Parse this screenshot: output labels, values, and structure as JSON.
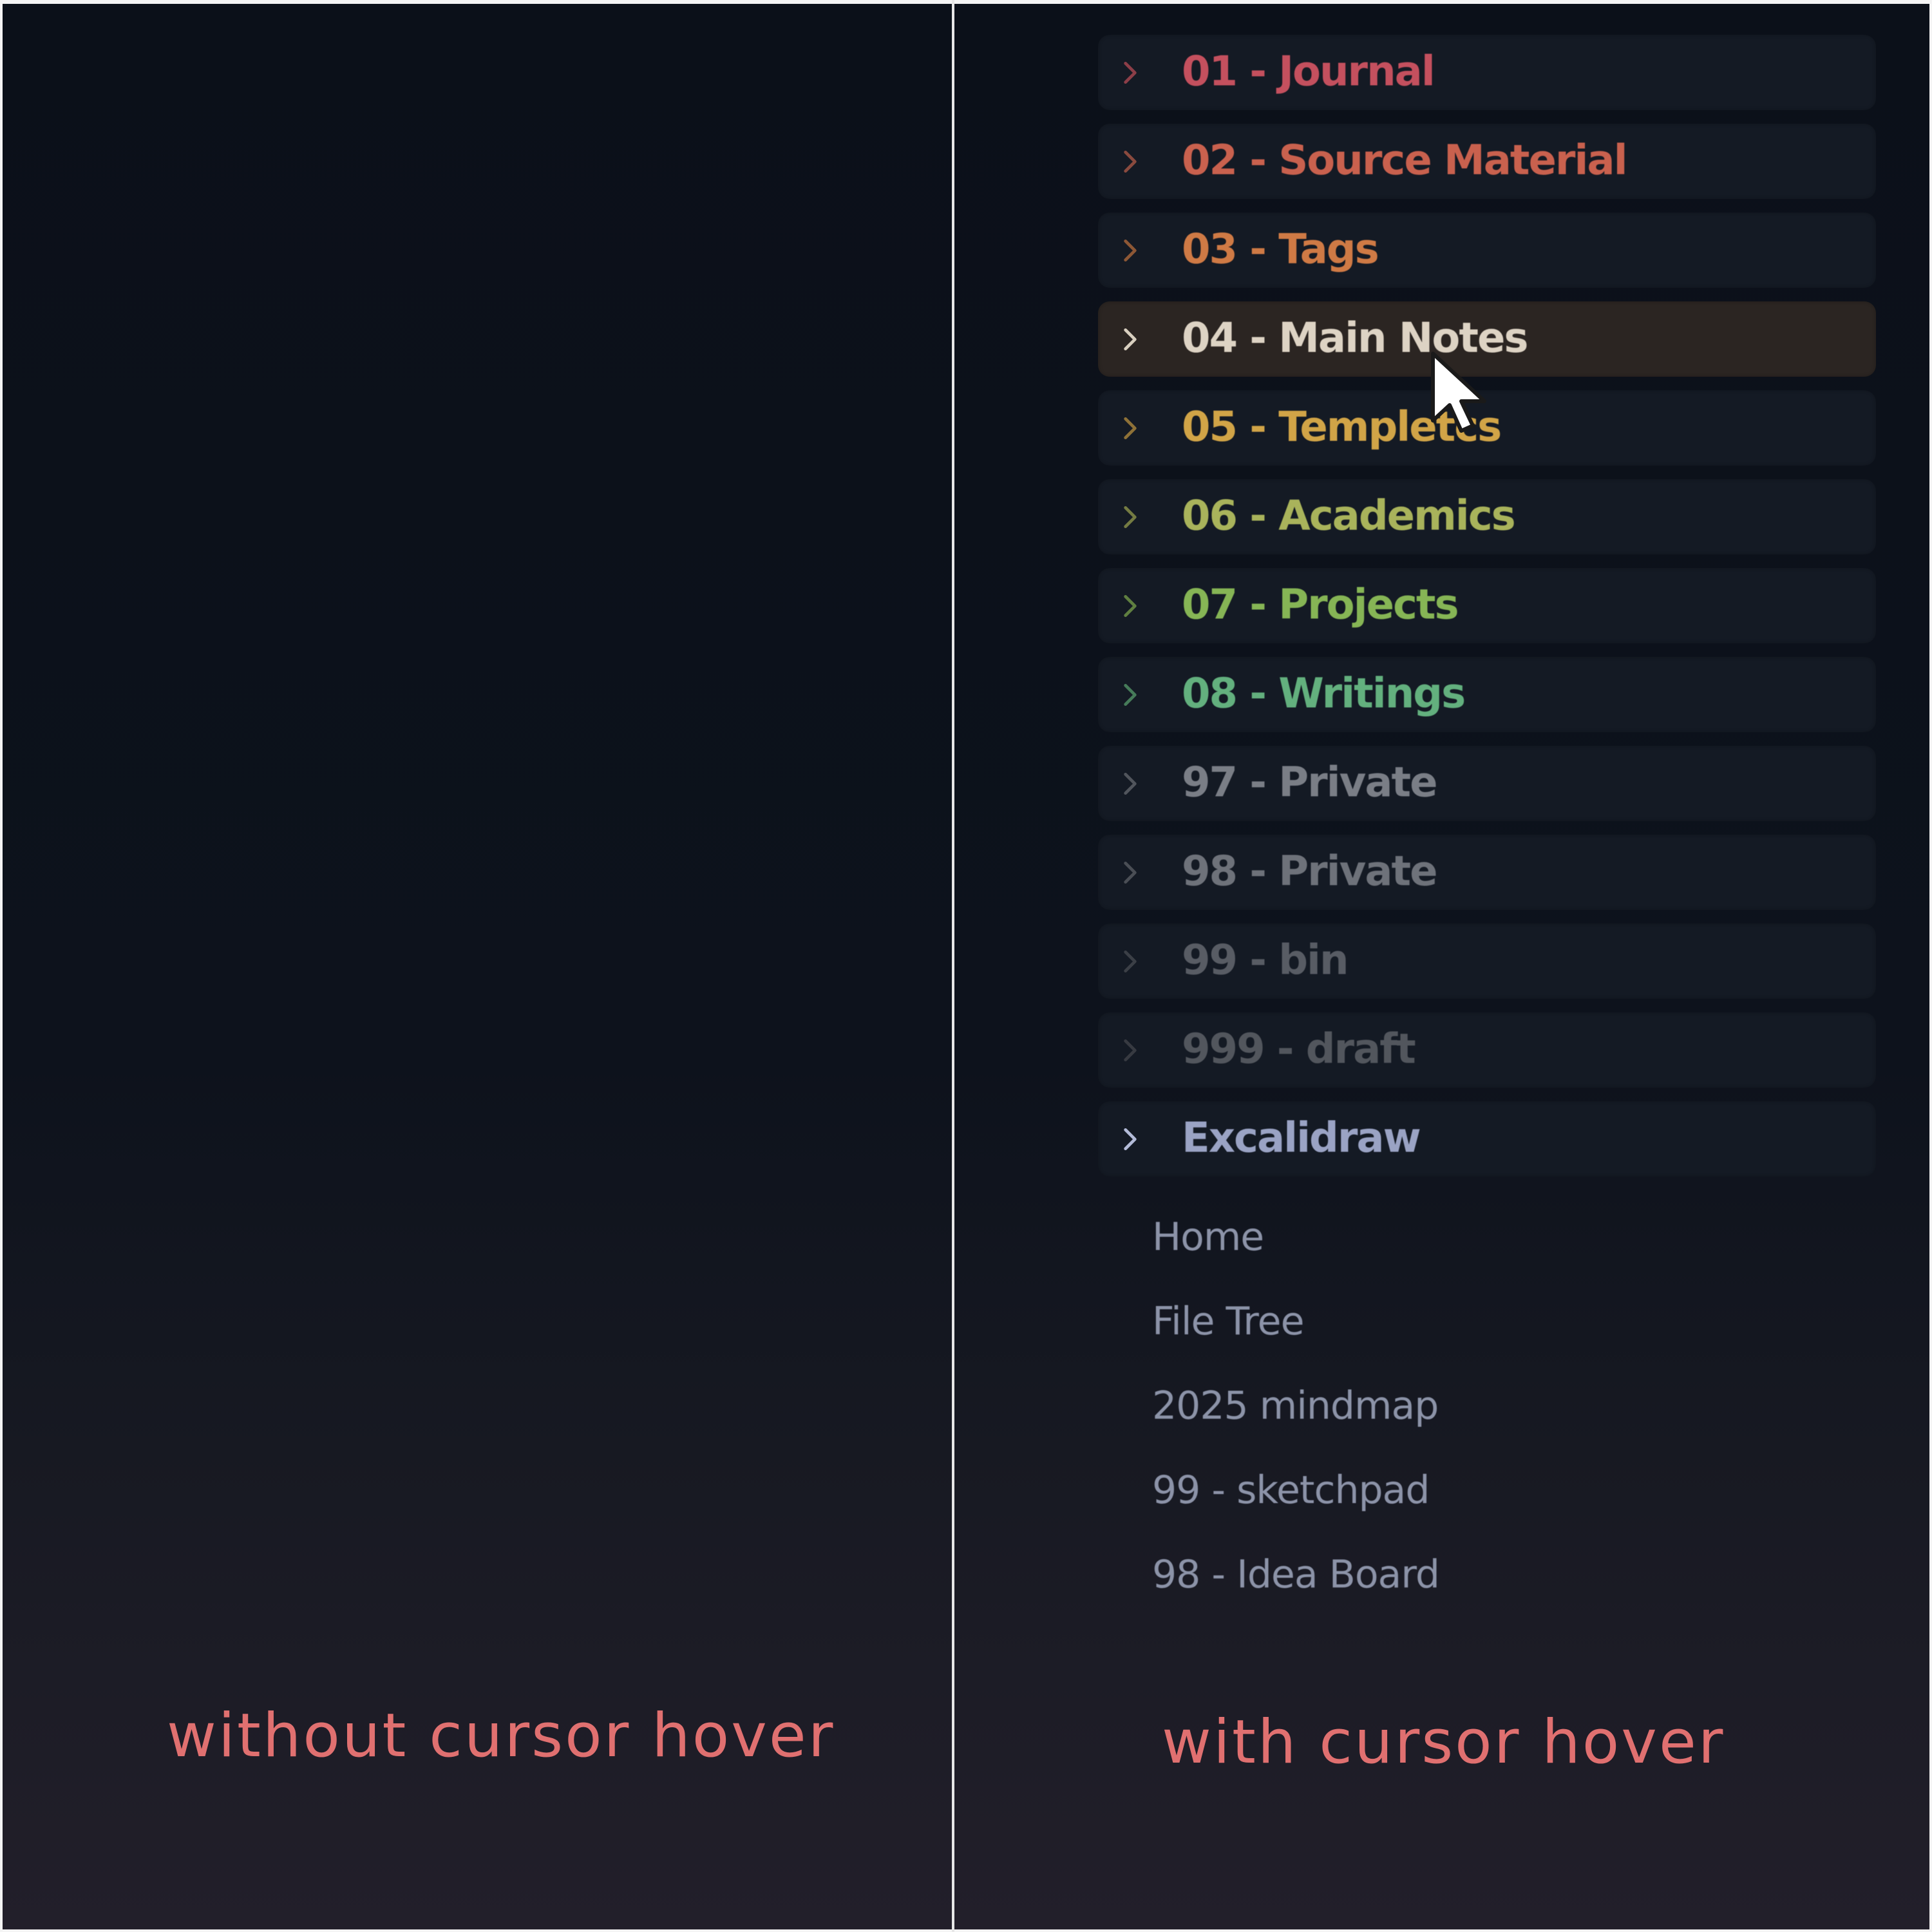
{
  "colors": {
    "caption": "#e07070",
    "folder_bg": "#141a24",
    "folder_hover_bg": "#2b2522",
    "file_text": "#8c93a8"
  },
  "captions": {
    "left": "without cursor hover",
    "right": "with cursor hover"
  },
  "folders": [
    {
      "label": "01 - Journal",
      "color": "#c4505e",
      "chevron_color": "#8c3e48",
      "hovered": false
    },
    {
      "label": "02 - Source Material",
      "color": "#c9614e",
      "chevron_color": "#8a4a3e",
      "hovered": false
    },
    {
      "label": "03 - Tags",
      "color": "#cf7a45",
      "chevron_color": "#8d5735",
      "hovered": false
    },
    {
      "label": "04 - Main Notes",
      "color": "#ddd3c4",
      "chevron_color": "#d8cfbf",
      "hovered": true
    },
    {
      "label": "05 - Templetcs",
      "color": "#d1a447",
      "chevron_color": "#8e7137",
      "hovered": false
    },
    {
      "label": "06 - Academics",
      "color": "#a9b35b",
      "chevron_color": "#747b42",
      "hovered": false
    },
    {
      "label": "07 - Projects",
      "color": "#86b555",
      "chevron_color": "#5f7f40",
      "hovered": false
    },
    {
      "label": "08 - Writings",
      "color": "#63b07e",
      "chevron_color": "#467b59",
      "hovered": false
    },
    {
      "label": "97 - Private",
      "color": "#7a7e86",
      "chevron_color": "#51555c",
      "hovered": false
    },
    {
      "label": "98 - Private",
      "color": "#6e727a",
      "chevron_color": "#4a4e55",
      "hovered": false
    },
    {
      "label": "99 - bin",
      "color": "#585c64",
      "chevron_color": "#3b3f46",
      "hovered": false
    },
    {
      "label": "999 - draft",
      "color": "#52565d",
      "chevron_color": "#373a41",
      "hovered": false
    },
    {
      "label": "Excalidraw",
      "color": "#9aa3c4",
      "chevron_color": "#b3bbd8",
      "hovered": false
    }
  ],
  "files": [
    {
      "label": "Home"
    },
    {
      "label": "File Tree"
    },
    {
      "label": "2025 mindmap"
    },
    {
      "label": "99 - sketchpad"
    },
    {
      "label": "98 - Idea Board"
    }
  ],
  "icons": {
    "folder_toggle": "chevron-right-icon",
    "pointer": "mouse-cursor-icon"
  }
}
